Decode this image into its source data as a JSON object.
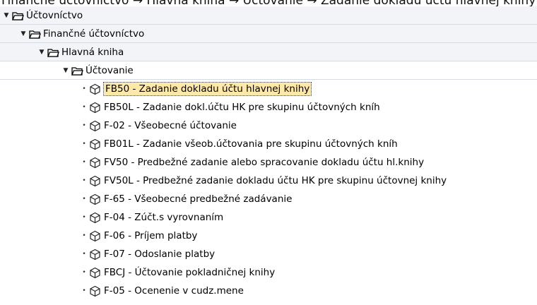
{
  "breadcrumb": "Finančné účtovníctvo  →  Hlavná kniha  →  Účtovanie  →  Zadanie dokladu účtu hlavnej knihy",
  "tree": {
    "folders": [
      {
        "label": "Účtovníctvo"
      },
      {
        "label": "Finančné účtovníctvo"
      },
      {
        "label": "Hlavná kniha"
      },
      {
        "label": "Účtovanie"
      }
    ],
    "transactions": [
      {
        "label": "FB50 - Zadanie dokladu účtu hlavnej knihy",
        "selected": true
      },
      {
        "label": "FB50L - Zadanie dokl.účtu HK pre skupinu účtovných kníh"
      },
      {
        "label": "F-02 - Všeobecné účtovanie"
      },
      {
        "label": "FB01L - Zadanie všeob.účtovania pre skupinu účtovných kníh"
      },
      {
        "label": "FV50 - Predbežné zadanie alebo spracovanie dokladu účtu hl.knihy"
      },
      {
        "label": "FV50L - Predbežné zadanie dokladu účtu HK pre skupinu účtovnej knihy"
      },
      {
        "label": "F-65 - Všeobecné predbežné zadávanie"
      },
      {
        "label": "F-04 - Zúčt.s vyrovnaním"
      },
      {
        "label": "F-06 - Príjem platby"
      },
      {
        "label": "F-07 - Odoslanie platby"
      },
      {
        "label": "FBCJ - Účtovanie pokladničnej knihy"
      },
      {
        "label": "F-05 - Ocenenie v cudz.mene"
      }
    ]
  },
  "icons": {
    "expand": "triangle-down-icon",
    "folder": "open-folder-icon",
    "transaction": "cube-icon"
  }
}
